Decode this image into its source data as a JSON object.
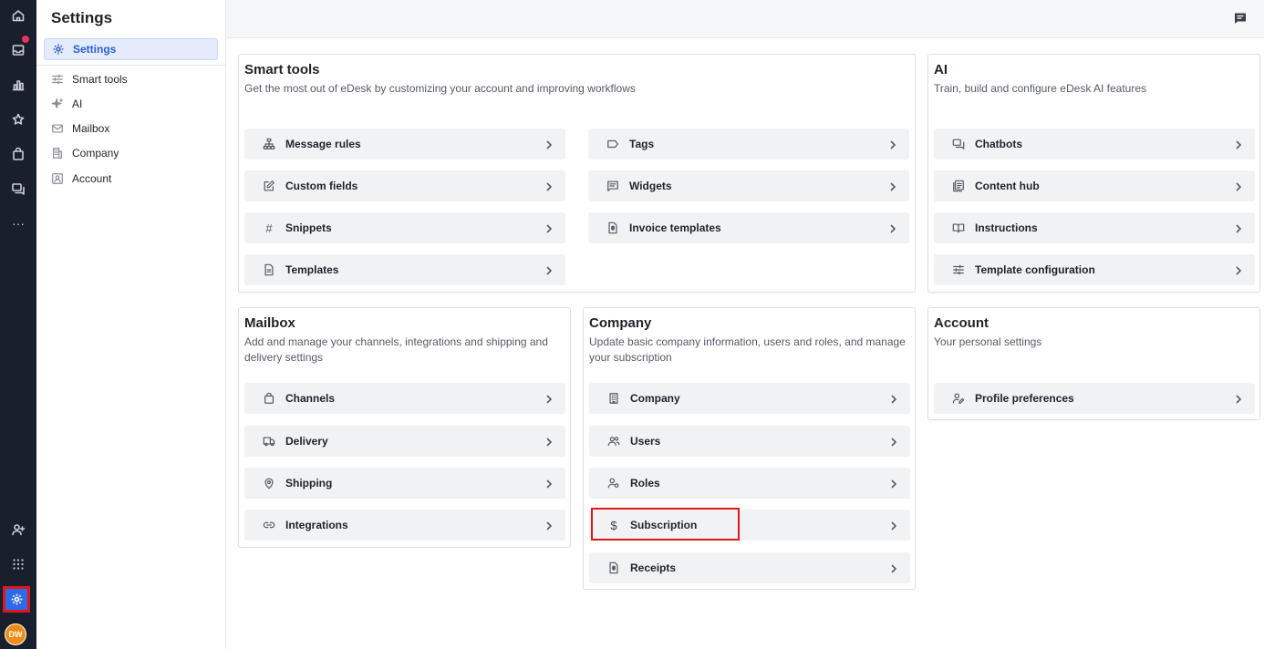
{
  "rail": {
    "items": [
      "home-icon",
      "inbox-icon",
      "reports-icon",
      "star-icon",
      "orders-icon",
      "chat-icon",
      "more-icon"
    ],
    "more_label": "···",
    "bottom": [
      "add-user-icon",
      "apps-grid-icon",
      "settings-icon"
    ],
    "avatar_initials": "DW"
  },
  "sidebar": {
    "title": "Settings",
    "active": "Settings",
    "items": [
      {
        "label": "Smart tools"
      },
      {
        "label": "AI"
      },
      {
        "label": "Mailbox"
      },
      {
        "label": "Company"
      },
      {
        "label": "Account"
      }
    ]
  },
  "cards": {
    "smart_tools": {
      "title": "Smart tools",
      "desc": "Get the most out of eDesk by customizing your account and improving workflows",
      "items": [
        "Message rules",
        "Tags",
        "Custom fields",
        "Widgets",
        "Snippets",
        "Invoice templates",
        "Templates"
      ]
    },
    "ai": {
      "title": "AI",
      "desc": "Train, build and configure eDesk AI features",
      "items": [
        "Chatbots",
        "Content hub",
        "Instructions",
        "Template configuration"
      ]
    },
    "mailbox": {
      "title": "Mailbox",
      "desc_line1": "Add and manage your channels, integrations and shipping and",
      "desc_line2": "delivery settings",
      "items": [
        "Channels",
        "Delivery",
        "Shipping",
        "Integrations"
      ]
    },
    "company": {
      "title": "Company",
      "desc_line1": "Update basic company information, users and roles, and manage",
      "desc_line2": "your subscription",
      "items": [
        "Company",
        "Users",
        "Roles",
        "Subscription",
        "Receipts"
      ]
    },
    "account": {
      "title": "Account",
      "desc": "Your personal settings",
      "items": [
        "Profile preferences"
      ]
    }
  },
  "glyphs": {
    "hash": "#",
    "dollar": "$"
  },
  "colors": {
    "accent": "#2c6ae8",
    "rail_bg": "#1a1f2e",
    "highlight": "#e0161c",
    "avatar": "#f08c13",
    "badge": "#e8315b"
  }
}
